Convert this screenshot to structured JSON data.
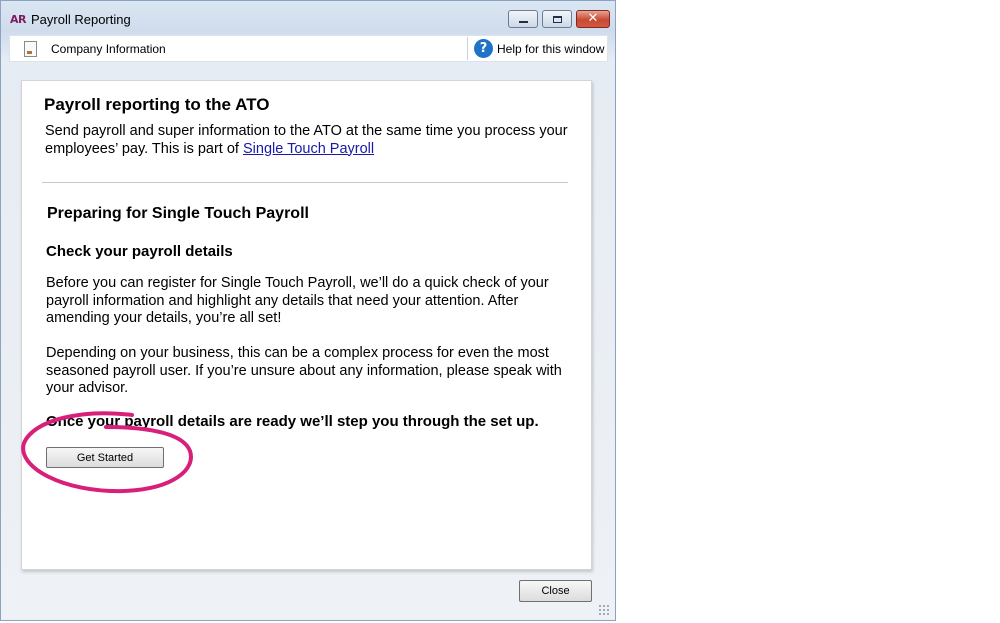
{
  "window": {
    "logo": "AR",
    "title": "Payroll Reporting"
  },
  "toolbar": {
    "company_info": "Company Information",
    "help": "Help for this window"
  },
  "content": {
    "heading": "Payroll reporting to the ATO",
    "intro_text": "Send payroll and super information to the ATO at the same time you process your employees’ pay. This is part of ",
    "intro_link": "Single Touch Payroll",
    "section_heading": "Preparing for Single Touch Payroll",
    "subheading": "Check your payroll details",
    "paragraph1": "Before you can register for Single Touch Payroll, we’ll do a quick check of your payroll information and highlight any details that need your attention. After amending your details, you’re all set!",
    "paragraph2": "Depending on your business, this can be a complex process for even the most seasoned payroll user. If you’re unsure about any information, please speak with your advisor.",
    "ready_text": "Once your payroll details are ready we’ll step you through the set up.",
    "get_started_label": "Get Started"
  },
  "footer": {
    "close_label": "Close"
  },
  "colors": {
    "link": "#1a1aa6",
    "annotation_circle": "#d81f7a",
    "help_icon": "#1e73c8"
  }
}
